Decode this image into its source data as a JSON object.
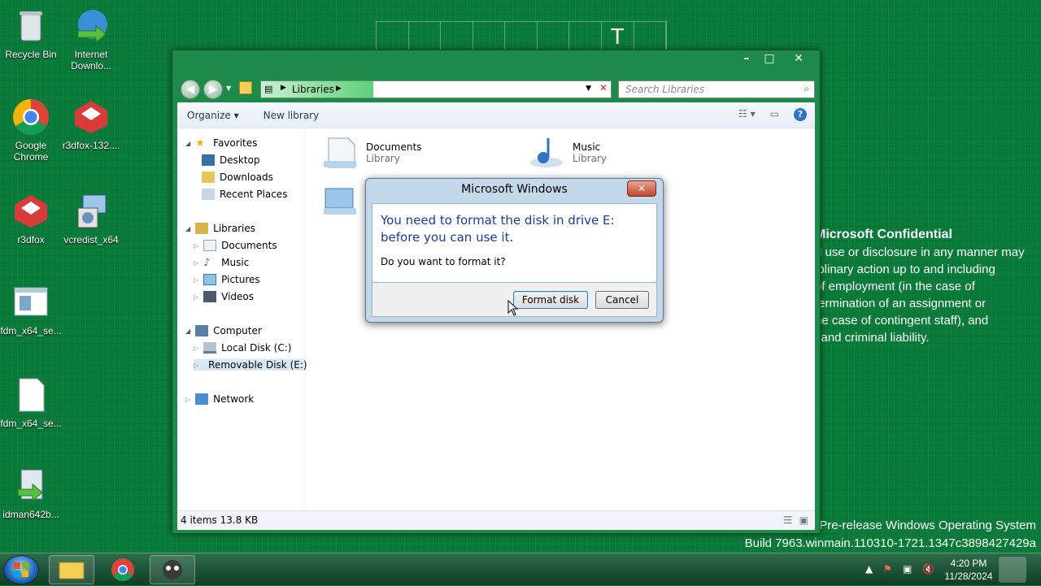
{
  "desktop": {
    "icons": [
      {
        "label": "Recycle Bin"
      },
      {
        "label": "Internet Downlo..."
      },
      {
        "label": "Google Chrome"
      },
      {
        "label": "r3dfox-132...."
      },
      {
        "label": "r3dfox"
      },
      {
        "label": "vcredist_x64"
      },
      {
        "label": "fdm_x64_se..."
      },
      {
        "label": "fdm_x64_se..."
      },
      {
        "label": "idman642b..."
      }
    ],
    "top_grid_letter": "T",
    "confidential": {
      "heading": "Microsoft Confidential",
      "lines": [
        "d use or disclosure in any manner may",
        "iplinary action up to and including",
        "of employment (in the case of",
        "termination of an assignment or",
        "he case of contingent staff), and",
        "l and criminal liability."
      ]
    },
    "watermark": {
      "line1": "Pre-release Windows Operating System",
      "line2": "Build 7963.winmain.110310-1721.1347c3898427429a"
    }
  },
  "explorer": {
    "address": "Libraries",
    "search_placeholder": "Search Libraries",
    "toolbar": {
      "organize": "Organize ▾",
      "new_library": "New library"
    },
    "nav": {
      "favorites": "Favorites",
      "desktop": "Desktop",
      "downloads": "Downloads",
      "recent": "Recent Places",
      "libraries": "Libraries",
      "documents": "Documents",
      "music": "Music",
      "pictures": "Pictures",
      "videos": "Videos",
      "computer": "Computer",
      "local_disk": "Local Disk (C:)",
      "removable": "Removable Disk (E:)",
      "network": "Network"
    },
    "libraries": [
      {
        "name": "Documents",
        "type": "Library"
      },
      {
        "name": "Music",
        "type": "Library"
      }
    ],
    "status": "4 items  13.8 KB"
  },
  "dialog": {
    "title": "Microsoft Windows",
    "message": "You need to format the disk in drive E: before you can use it.",
    "question": "Do you want to format it?",
    "format_button": "Format disk",
    "cancel_button": "Cancel"
  },
  "taskbar": {
    "time": "4:20 PM",
    "date": "11/28/2024"
  }
}
